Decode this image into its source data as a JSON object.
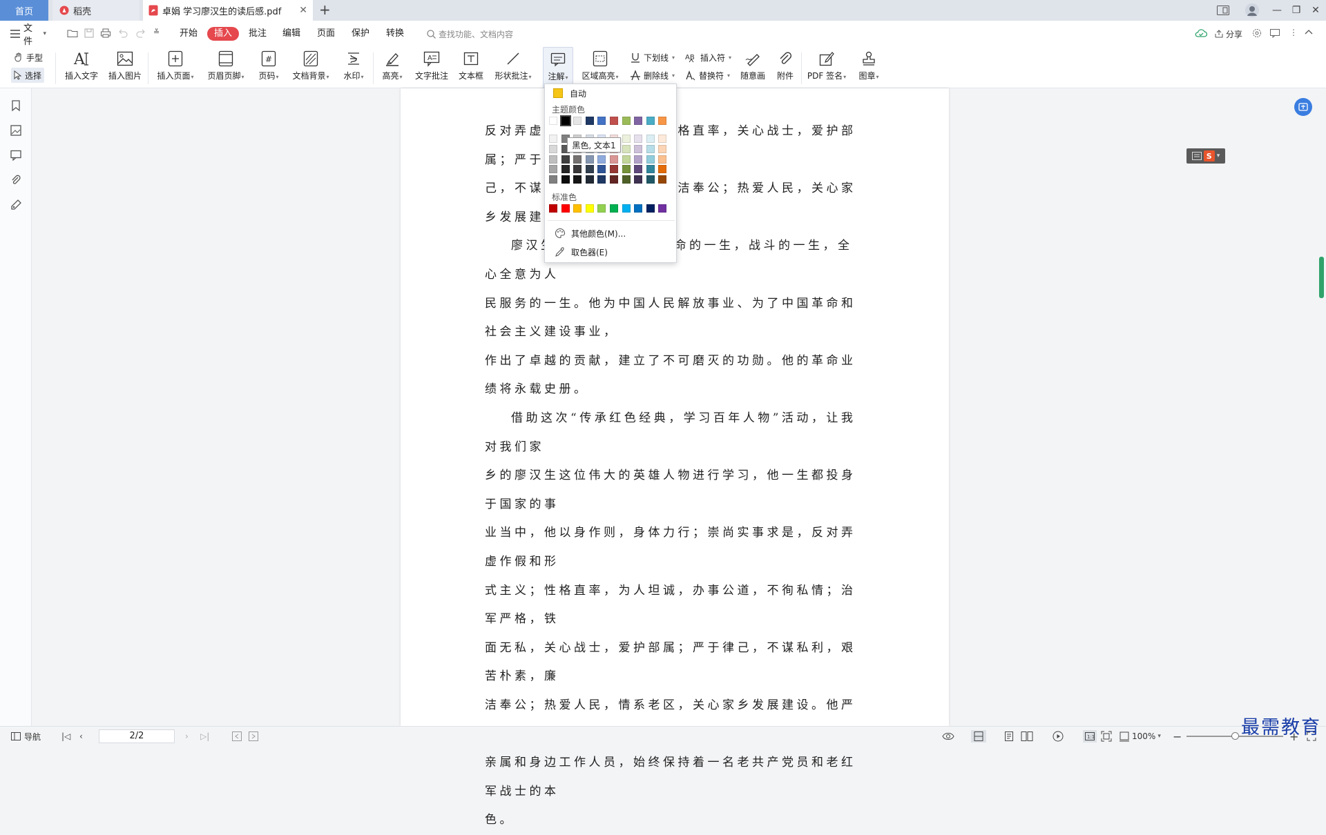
{
  "tabs": {
    "home": "首页",
    "daoke": "稻壳",
    "document": "卓娟 学习廖汉生的读后感.pdf"
  },
  "menu": {
    "file": "文件",
    "tabs": [
      "开始",
      "插入",
      "批注",
      "编辑",
      "页面",
      "保护",
      "转换"
    ],
    "active_tab": "插入",
    "search_placeholder": "查找功能、文档内容",
    "share": "分享"
  },
  "ribbon": {
    "hand": "手型",
    "select": "选择",
    "insert_text": "插入文字",
    "insert_image": "插入图片",
    "insert_page": "插入页面",
    "header_footer": "页眉页脚",
    "page_number": "页码",
    "doc_background": "文档背景",
    "watermark": "水印",
    "highlight": "高亮",
    "text_comment": "文字批注",
    "text_box": "文本框",
    "shape_comment": "形状批注",
    "annotation": "注解",
    "area_highlight": "区域高亮",
    "underline": "下划线",
    "strikethrough": "删除线",
    "insert_symbol": "插入符",
    "replace_symbol": "替换符",
    "freehand": "随意画",
    "attachment": "附件",
    "pdf_sign": "PDF 签名",
    "stamp": "图章"
  },
  "color_dropdown": {
    "auto": "自动",
    "theme_colors_title": "主题颜色",
    "standard_colors_title": "标准色",
    "more_colors": "其他颜色(M)...",
    "eyedropper": "取色器(E)",
    "tooltip": "黑色, 文本1",
    "theme_top_row": [
      "#ffffff",
      "#000000",
      "#e7e6e6",
      "#1f3864",
      "#4472c4",
      "#c0504d",
      "#9bbb59",
      "#8064a2",
      "#4bacc6",
      "#f79646"
    ],
    "theme_shade_columns": [
      [
        "#f2f2f2",
        "#d9d9d9",
        "#bfbfbf",
        "#a6a6a6",
        "#808080"
      ],
      [
        "#7f7f7f",
        "#595959",
        "#404040",
        "#262626",
        "#0d0d0d"
      ],
      [
        "#d0cece",
        "#aeabab",
        "#757171",
        "#3a3838",
        "#171616"
      ],
      [
        "#d6dce4",
        "#adb9ca",
        "#8496b0",
        "#323f4f",
        "#222a35"
      ],
      [
        "#dae3f3",
        "#b4c7e7",
        "#8faadc",
        "#2f5597",
        "#1f3864"
      ],
      [
        "#f2dcdb",
        "#e6b9b8",
        "#d99694",
        "#953734",
        "#632523"
      ],
      [
        "#ebf1dd",
        "#d7e3bc",
        "#c3d69b",
        "#76923c",
        "#4f6128"
      ],
      [
        "#e5e0ec",
        "#ccc1d9",
        "#b2a2c7",
        "#5f497a",
        "#3f3151"
      ],
      [
        "#dbeef3",
        "#b7dde8",
        "#92cddc",
        "#31859b",
        "#205867"
      ],
      [
        "#fdeada",
        "#fbd5b5",
        "#fac08f",
        "#e36c09",
        "#974806"
      ]
    ],
    "standard": [
      "#c00000",
      "#ff0000",
      "#ffc000",
      "#ffff00",
      "#92d050",
      "#00b050",
      "#00b0f0",
      "#0070c0",
      "#002060",
      "#7030a0"
    ],
    "selected_color": "#000000"
  },
  "document": {
    "lines": [
      {
        "text": "反对弄虚作假和形式主义；性格直率，关心战士，爱护部属；严于律",
        "indent": false
      },
      {
        "text": "己，不谋私利，艰苦朴素，廉洁奉公；热爱人民，关心家乡发展建设。",
        "indent": false
      },
      {
        "text": "廖汉生同志的一生，是革命的一生，战斗的一生，全心全意为人",
        "indent": true
      },
      {
        "text": "民服务的一生。他为中国人民解放事业、为了中国革命和社会主义建设事业，",
        "indent": false
      },
      {
        "text": "作出了卓越的贡献，建立了不可磨灭的功勋。他的革命业绩将永载史册。",
        "indent": false
      },
      {
        "text": "借助这次“传承红色经典，学习百年人物”活动，让我对我们家",
        "indent": true
      },
      {
        "text": "乡的廖汉生这位伟大的英雄人物进行学习，他一生都投身于国家的事",
        "indent": false
      },
      {
        "text": "业当中，他以身作则，身体力行；崇尚实事求是，反对弄虚作假和形",
        "indent": false
      },
      {
        "text": "式主义；性格直率，为人坦诚，办事公道，不徇私情；治军严格，铁",
        "indent": false
      },
      {
        "text": "面无私，关心战士，爱护部属；严于律己，不谋私利，艰苦朴素，廉",
        "indent": false
      },
      {
        "text": "洁奉公；热爱人民，情系老区，关心家乡发展建设。他严格要求子女",
        "indent": false
      },
      {
        "text": "亲属和身边工作人员，始终保持着一名老共产党员和老红军战士的本",
        "indent": false
      },
      {
        "text": "色。",
        "indent": false
      }
    ]
  },
  "status": {
    "nav": "导航",
    "page": "2/2",
    "zoom": "100%"
  },
  "watermark": "最需教育"
}
